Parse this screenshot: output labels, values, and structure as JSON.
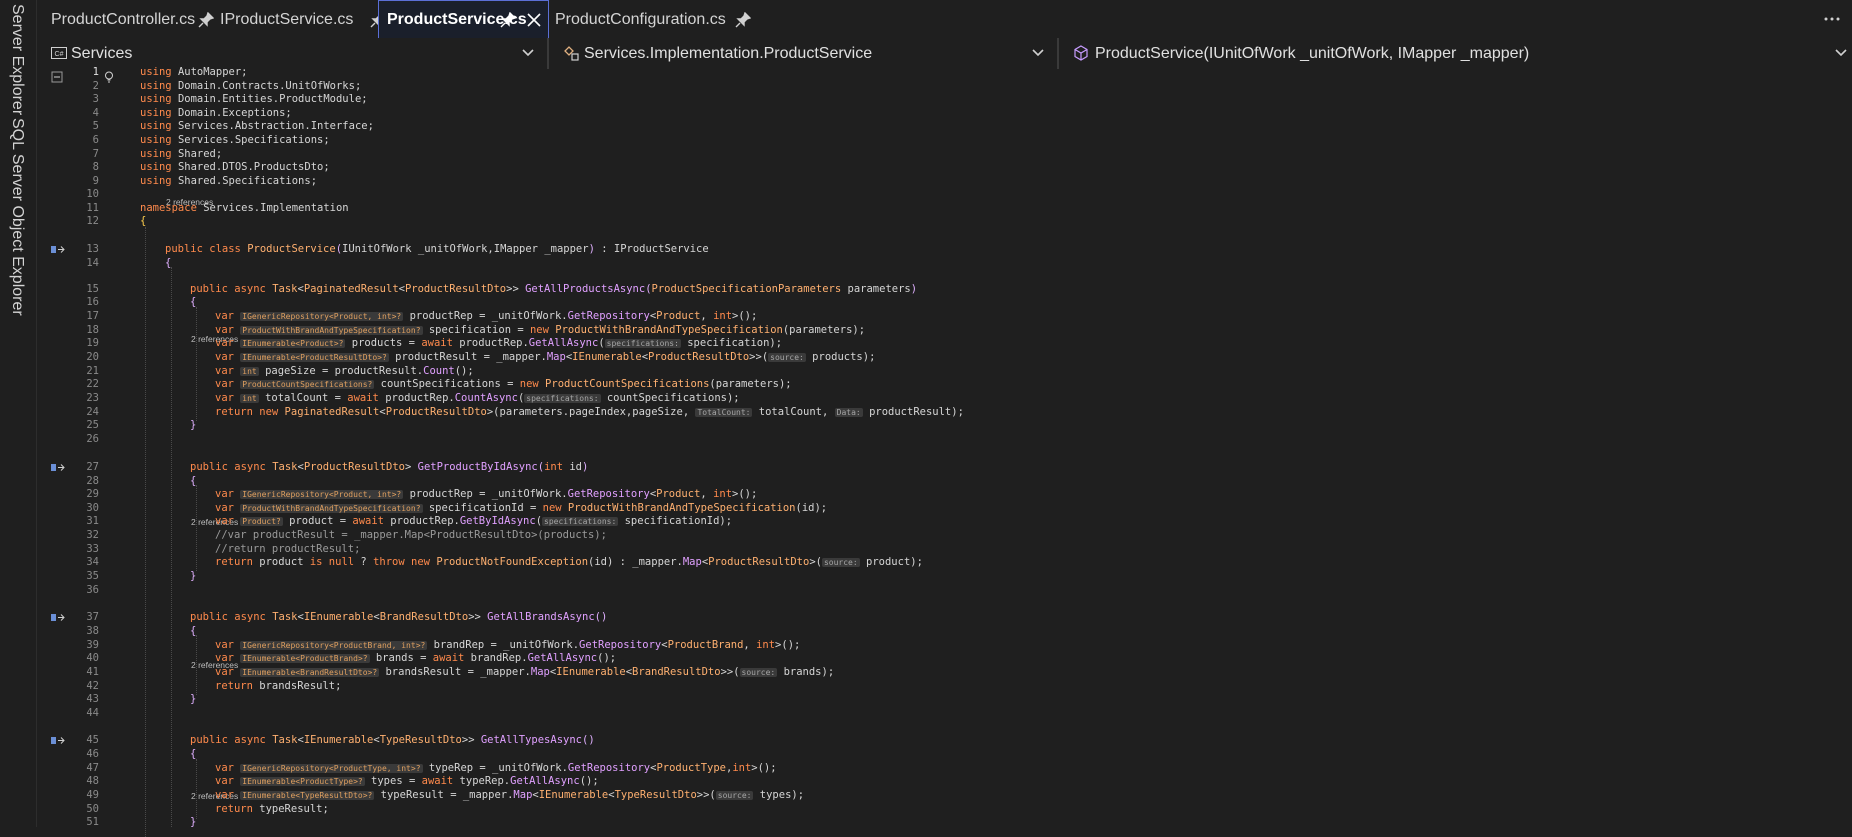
{
  "side_panel": {
    "items": [
      "Server Explorer",
      "SQL Server Object Explorer"
    ]
  },
  "tabs": [
    {
      "label": "ProductController.cs",
      "active": false
    },
    {
      "label": "IProductService.cs",
      "active": false
    },
    {
      "label": "ProductService.cs",
      "active": true
    },
    {
      "label": "ProductConfiguration.cs",
      "active": false
    }
  ],
  "navbar": {
    "project": "Services",
    "type": "Services.Implementation.ProductService",
    "member": "ProductService(IUnitOfWork _unitOfWork, IMapper _mapper)"
  },
  "line_numbers": [
    "1",
    "2",
    "3",
    "4",
    "5",
    "6",
    "7",
    "8",
    "9",
    "10",
    "11",
    "12",
    "13",
    "14",
    "15",
    "16",
    "17",
    "18",
    "19",
    "20",
    "21",
    "22",
    "23",
    "24",
    "25",
    "26",
    "27",
    "28",
    "29",
    "30",
    "31",
    "32",
    "33",
    "34",
    "35",
    "36",
    "37",
    "38",
    "39",
    "40",
    "41",
    "42",
    "43",
    "44",
    "45",
    "46",
    "47",
    "48",
    "49",
    "50",
    "51"
  ],
  "reference_labels": [
    "2 references",
    "2 references",
    "2 references",
    "2 references",
    "2 references"
  ],
  "code": {
    "using_kw": "using",
    "usings": [
      "AutoMapper",
      "Domain.Contracts.UnitOfWorks",
      "Domain.Entities.ProductModule",
      "Domain.Exceptions",
      "Services.Abstraction.Interface",
      "Services.Specifications",
      "Shared",
      "Shared.DTOS.ProductsDto",
      "Shared.Specifications"
    ],
    "namespace_kw": "namespace",
    "namespace": "Services.Implementation",
    "class_decl": {
      "mods": "public class",
      "name": "ProductService",
      "params": "IUnitOfWork _unitOfWork,IMapper _mapper",
      "base": "IProductService"
    },
    "comments": [
      "//var productResult = _mapper.Map<ProductResultDto>(products);",
      "//return productResult;"
    ],
    "hints": {
      "repo_product": "IGenericRepository<Product, int>?",
      "spec_brand_type": "ProductWithBrandAndTypeSpecification?",
      "ienum_product": "IEnumerable<Product>?",
      "ienum_product_dto": "IEnumerable<ProductResultDto>?",
      "int": "int",
      "count_spec": "ProductCountSpecifications?",
      "product": "Product?",
      "repo_brand": "IGenericRepository<ProductBrand, int>?",
      "ienum_brand": "IEnumerable<ProductBrand>?",
      "ienum_brand_dto": "IEnumerable<BrandResultDto>?",
      "repo_type": "IGenericRepository<ProductType, int>?",
      "ienum_type": "IEnumerable<ProductType>?",
      "ienum_type_dto": "IEnumerable<TypeResultDto>?",
      "p_specifications": "specifications:",
      "p_source": "source:",
      "p_totalcount": "TotalCount:",
      "p_data": "Data:"
    }
  },
  "colors": {
    "accent": "#5b6fd6",
    "keyword": "#ff8a4c",
    "method": "#e0a0ff",
    "editor_bg": "#1f1f1f"
  },
  "icons": [
    "pin-icon",
    "close-icon",
    "more-icon",
    "csharp-project-icon",
    "class-icon",
    "method-cube-icon",
    "chevron-down-icon",
    "lightbulb-icon",
    "collapse-icon"
  ]
}
